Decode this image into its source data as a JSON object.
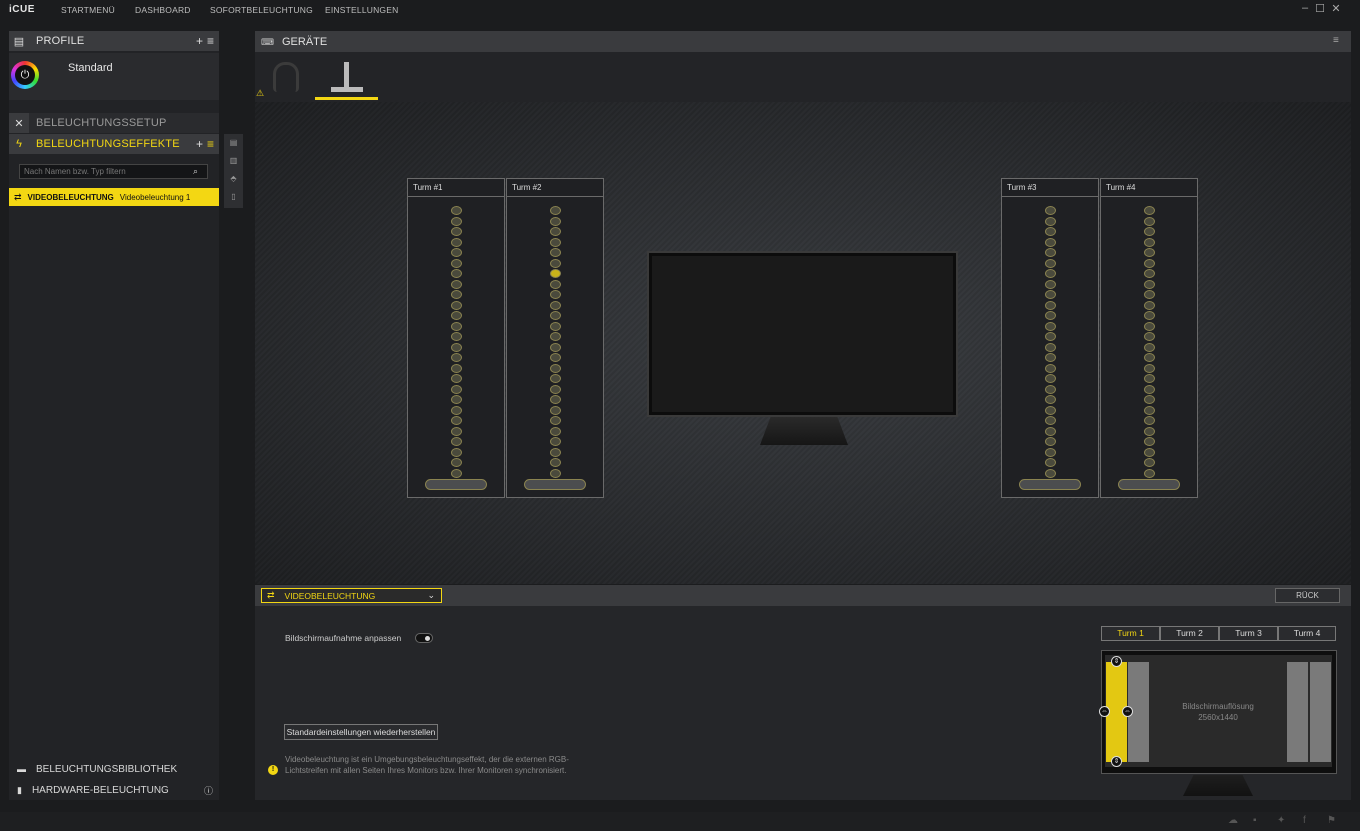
{
  "app": {
    "title": "iCUE"
  },
  "nav": [
    "STARTMENÜ",
    "DASHBOARD",
    "SOFORTBELEUCHTUNG",
    "EINSTELLUNGEN"
  ],
  "profile": {
    "header": "PROFILE",
    "name": "Standard"
  },
  "sidebar": {
    "setup": "BELEUCHTUNGSSETUP",
    "effects": "BELEUCHTUNGSEFFEKTE",
    "search_placeholder": "Nach Namen bzw. Typ filtern",
    "effect_item": {
      "type": "VIDEOBELEUCHTUNG",
      "name": "Videobeleuchtung 1"
    },
    "library": "BELEUCHTUNGSBIBLIOTHEK",
    "hardware": "HARDWARE-BELEUCHTUNG"
  },
  "devices": {
    "header": "GERÄTE"
  },
  "towers": [
    "Turm #1",
    "Turm #2",
    "Turm #3",
    "Turm #4"
  ],
  "effect_panel": {
    "dropdown": "VIDEOBELEUCHTUNG",
    "back": "RÜCK",
    "capture_label": "Bildschirmaufnahme anpassen",
    "reset_button": "Standardeinstellungen wiederherstellen",
    "info": "Videobeleuchtung ist ein Umgebungsbeleuchtungseffekt, der die externen RGB-Lichtstreifen mit allen Seiten Ihres Monitors bzw. Ihrer Monitoren synchronisiert.",
    "turn_tabs": [
      "Turm 1",
      "Turm 2",
      "Turm 3",
      "Turm 4"
    ],
    "resolution_label": "Bildschirmauflösung",
    "resolution_value": "2560x1440"
  },
  "colors": {
    "accent": "#f3d713"
  }
}
